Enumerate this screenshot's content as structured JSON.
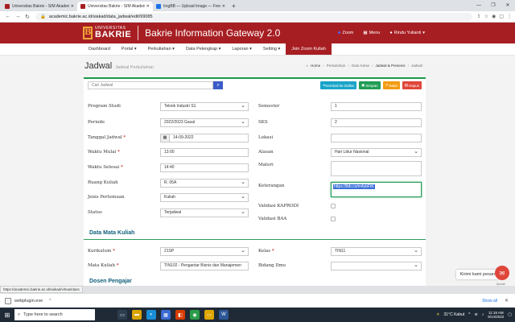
{
  "browser": {
    "tabs": [
      {
        "title": "Universitas Bakrie - SIM Akadem",
        "active": false,
        "color": "#a71e22"
      },
      {
        "title": "Universitas Bakrie - SIM Akadem",
        "active": true,
        "color": "#a71e22"
      },
      {
        "title": "ImgBB — Upload Image — Free",
        "active": false,
        "color": "#1a73e8"
      }
    ],
    "url": "academic.bakrie.ac.id/siakad/data_jadwal/edit/99085"
  },
  "header": {
    "logo_letter": "B",
    "logo_top": "UNIVERSITAS",
    "logo_bottom": "BAKRIE",
    "app_title": "Bakrie Information Gateway 2.0",
    "zoom_label": "Zoom",
    "menu_label": "Menu",
    "user_name": "Rindu Yulianti"
  },
  "menubar": [
    {
      "label": "Dashboard",
      "active": false
    },
    {
      "label": "Portal ▾",
      "active": false
    },
    {
      "label": "Perkuliahan ▾",
      "active": false
    },
    {
      "label": "Data Pelengkap ▾",
      "active": false
    },
    {
      "label": "Laporan ▾",
      "active": false
    },
    {
      "label": "Setting ▾",
      "active": false
    },
    {
      "label": "Join Zoom Kuliah",
      "active": true
    }
  ],
  "page": {
    "title": "Jadwal",
    "subtitle": "Jadwal Perkuliahan",
    "breadcrumb": [
      "Home",
      "Perkuliahan",
      "Data Kelas",
      "Jadwal & Presensi",
      "Jadwal"
    ]
  },
  "search": {
    "placeholder": "Cari Jadwal"
  },
  "actions": {
    "back": "Kembali ke Daftar",
    "save": "Simpan",
    "cancel": "Batal",
    "delete": "Hapus"
  },
  "form_left": [
    {
      "label": "Program Studi",
      "required": false,
      "value": "Teknik Industri S1",
      "type": "select"
    },
    {
      "label": "Periode",
      "required": false,
      "value": "2022/2023 Gasal",
      "type": "select"
    },
    {
      "label": "Tanggal Jadwal",
      "required": true,
      "value": "14-09-2022",
      "type": "date"
    },
    {
      "label": "Waktu Mulai",
      "required": true,
      "value": "13:00",
      "type": "text"
    },
    {
      "label": "Waktu Selesai",
      "required": true,
      "value": "14:40",
      "type": "text"
    },
    {
      "label": "Ruang Kuliah",
      "required": false,
      "value": "R. 05A",
      "type": "select"
    },
    {
      "label": "Jenis Pertemuan",
      "required": false,
      "value": "Kuliah",
      "type": "select"
    },
    {
      "label": "Status",
      "required": false,
      "value": "Terjadwal",
      "type": "select"
    }
  ],
  "form_right": {
    "semester": {
      "label": "Semester",
      "value": "1"
    },
    "sks": {
      "label": "SKS",
      "value": "2"
    },
    "lokasi": {
      "label": "Lokasi",
      "value": ""
    },
    "alasan": {
      "label": "Alasan",
      "value": "Hari Libur Nasional"
    },
    "materi": {
      "label": "Materi",
      "value": ""
    },
    "keterangan": {
      "label": "Keterangan",
      "value": "https://ibb.co/m4ybFtK"
    },
    "validasi_kaprodi": {
      "label": "Validasi KAPRODI"
    },
    "validasi_baa": {
      "label": "Validasi BAA"
    }
  },
  "section_mata_kuliah": {
    "title": "Data Mata Kuliah",
    "kurikulum": {
      "label": "Kurikulum",
      "value": "21SP"
    },
    "mata_kuliah": {
      "label": "Mata Kuliah",
      "value": "TIN102 - Pengantar Bisnis dan Manajemen"
    },
    "kelas": {
      "label": "Kelas",
      "value": "TIN11"
    },
    "bidang_ilmu": {
      "label": "Bidang Ilmu",
      "value": ""
    }
  },
  "section_dosen": {
    "title": "Dosen Pengajar"
  },
  "chat": {
    "label": "Kirimi kami pesan",
    "brand": "Qontak"
  },
  "status_link": "https://academic.bakrie.ac.id/siakad/virtualclass",
  "downloads": {
    "file": "webplugin.exe",
    "show_all": "Show all"
  },
  "taskbar": {
    "search_placeholder": "Type here to search",
    "weather": "31°C Kabut",
    "time": "11:19 AM",
    "date": "9/14/2022"
  },
  "colors": {
    "brand_red": "#a71e22",
    "accent_green": "#1a9c4c",
    "section_blue": "#0d5f7a"
  }
}
